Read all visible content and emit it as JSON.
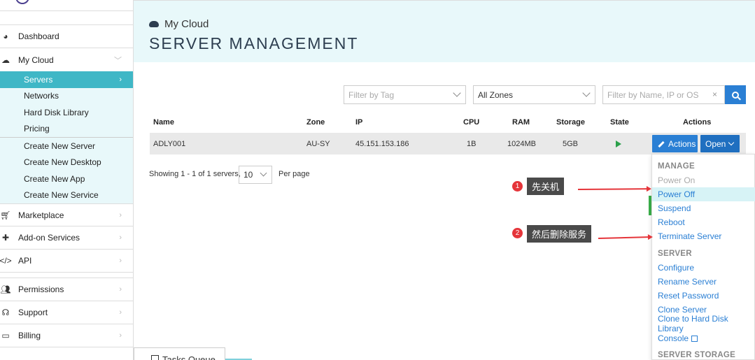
{
  "sidebar": {
    "items": [
      {
        "label": "Dashboard",
        "icon": "dashboard-icon"
      },
      {
        "label": "My Cloud",
        "icon": "cloud-icon"
      },
      {
        "label": "Marketplace",
        "icon": "cart-icon"
      },
      {
        "label": "Add-on Services",
        "icon": "puzzle-icon"
      },
      {
        "label": "API",
        "icon": "code-icon"
      },
      {
        "label": "Permissions",
        "icon": "users-icon"
      },
      {
        "label": "Support",
        "icon": "headset-icon"
      },
      {
        "label": "Billing",
        "icon": "credit-card-icon"
      }
    ],
    "cloud_sub": [
      "Servers",
      "Networks",
      "Hard Disk Library",
      "Pricing"
    ],
    "create_sub": [
      "Create New Server",
      "Create New Desktop",
      "Create New App",
      "Create New Service"
    ]
  },
  "tasks_queue": "Tasks Queue",
  "header": {
    "breadcrumb": "My Cloud",
    "title": "SERVER MANAGEMENT"
  },
  "filters": {
    "tag_placeholder": "Filter by Tag",
    "zone_value": "All Zones",
    "search_placeholder": "Filter by Name, IP or OS",
    "clear": "×"
  },
  "table": {
    "headers": {
      "name": "Name",
      "zone": "Zone",
      "ip": "IP",
      "cpu": "CPU",
      "ram": "RAM",
      "storage": "Storage",
      "state": "State",
      "actions": "Actions"
    },
    "row": {
      "name": "ADLY001",
      "zone": "AU-SY",
      "ip": "45.151.153.186",
      "cpu": "1B",
      "ram": "1024MB",
      "storage": "5GB",
      "state": "running"
    }
  },
  "buttons": {
    "actions": "Actions",
    "open": "Open"
  },
  "pagination": {
    "showing": "Showing 1 - 1 of 1 servers,",
    "per_page_value": "10",
    "per_page_label": "Per page"
  },
  "menu": {
    "manage_header": "MANAGE",
    "manage": [
      "Power On",
      "Power Off",
      "Suspend",
      "Reboot",
      "Terminate Server"
    ],
    "server_header": "SERVER",
    "server": [
      "Configure",
      "Rename Server",
      "Reset Password",
      "Clone Server",
      "Clone to Hard Disk Library",
      "Console"
    ],
    "storage_header": "SERVER STORAGE"
  },
  "annotations": [
    {
      "num": "1",
      "text": "先关机"
    },
    {
      "num": "2",
      "text": "然后删除服务"
    }
  ],
  "colors": {
    "accent": "#3fb7c6",
    "primary": "#2a7fd4",
    "annotation": "#e5353a",
    "header_bg": "#e8f8fa"
  }
}
